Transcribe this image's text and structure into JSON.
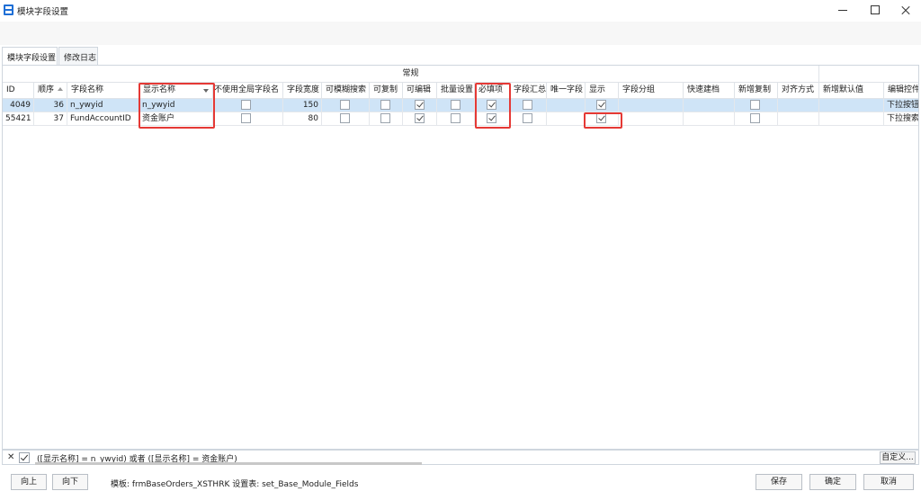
{
  "window": {
    "title": "模块字段设置"
  },
  "tabs": [
    {
      "label": "模块字段设置"
    },
    {
      "label": "修改日志"
    }
  ],
  "grid": {
    "band_label": "常规",
    "columns": {
      "id": "ID",
      "seq": "顺序",
      "field": "字段名称",
      "display": "显示名称",
      "no_global": "不使用全局字段名",
      "width": "字段宽度",
      "fuzzy": "可模糊搜索",
      "copy": "可复制",
      "edit": "可编辑",
      "batch": "批量设置",
      "required": "必填项",
      "sum": "字段汇总",
      "unique": "唯一字段",
      "show": "显示",
      "group": "字段分组",
      "quick": "快速建档",
      "newcopy": "新增复制",
      "align": "对齐方式",
      "default": "新增默认值",
      "editor": "编辑控件"
    },
    "rows": [
      {
        "id": "4049",
        "seq": "36",
        "field": "n_ywyid",
        "display": "n_ywyid",
        "width": "150",
        "no_global": false,
        "fuzzy": false,
        "copy": false,
        "edit": true,
        "batch": false,
        "required": true,
        "sum": false,
        "show": true,
        "newcopy": false,
        "editor": "下拉按钮框"
      },
      {
        "id": "55421",
        "seq": "37",
        "field": "FundAccountID",
        "display": "资金账户",
        "width": "80",
        "no_global": false,
        "fuzzy": false,
        "copy": false,
        "edit": true,
        "batch": false,
        "required": true,
        "sum": false,
        "show": true,
        "newcopy": false,
        "editor": "下拉搜索框"
      }
    ]
  },
  "filter": {
    "text": "([显示名称] = n_ywyid) 或者 ([显示名称] = 资金账户)",
    "custom_label": "自定义..."
  },
  "footer": {
    "up_label": "向上",
    "down_label": "向下",
    "info": "模板: frmBaseOrders_XSTHRK  设置表: set_Base_Module_Fields",
    "save_label": "保存",
    "ok_label": "确定",
    "cancel_label": "取消"
  }
}
